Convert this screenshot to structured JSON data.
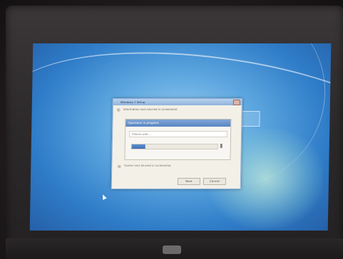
{
  "dialog": {
    "title": "Windows 7 Setup",
    "info_text": "Information text blurred in screenshot",
    "inner_title": "Operation in progress",
    "field_text": "Please wait...",
    "progress": 0.16,
    "footer_text": "Footer text blurred in screenshot",
    "next_label": "Next",
    "cancel_label": "Cancel"
  },
  "colors": {
    "desktop": "#2f7cc8",
    "dialog_bg": "#f3f0e8",
    "progress": "#3f6fb4"
  }
}
